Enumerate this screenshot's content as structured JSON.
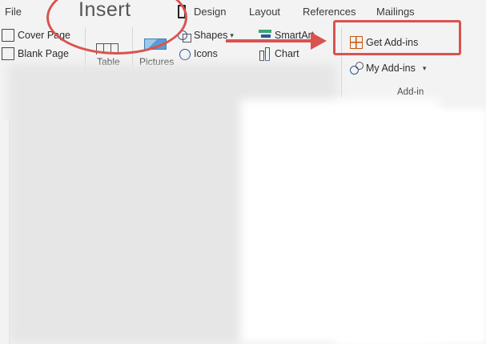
{
  "tabs": {
    "file": "File",
    "insert": "Insert",
    "design": "Design",
    "layout": "Layout",
    "references": "References",
    "mailings": "Mailings"
  },
  "pages_group": {
    "cover_page": "Cover Page",
    "blank_page": "Blank Page"
  },
  "tables_group": {
    "table": "Table"
  },
  "illustrations_group": {
    "pictures": "Pictures",
    "shapes": "Shapes",
    "icons": "Icons",
    "smartart": "SmartArt",
    "chart": "Chart"
  },
  "addins_group": {
    "get_addins": "Get Add-ins",
    "my_addins": "My Add-ins",
    "group_label": "Add-in"
  },
  "colors": {
    "annotation_red": "#d9534f",
    "accent_blue": "#2b579a",
    "ribbon_bg": "#f3f3f3"
  },
  "icons": {
    "cover_page": "cover-page-icon",
    "blank_page": "blank-page-icon",
    "shapes": "shapes-icon",
    "icons": "icons-icon",
    "smartart": "smartart-icon",
    "chart": "chart-icon",
    "get_addins": "store-grid-icon",
    "my_addins": "my-addins-icon"
  }
}
